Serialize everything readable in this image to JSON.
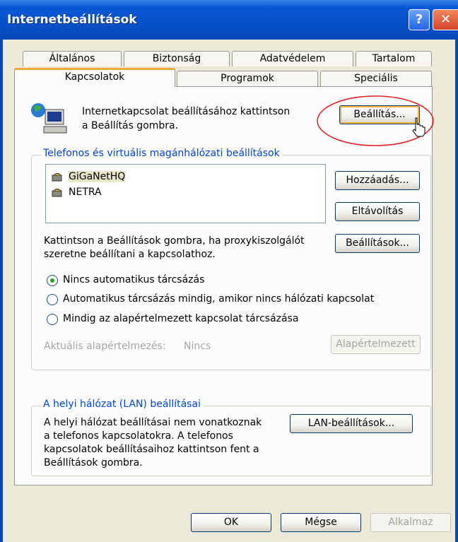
{
  "window": {
    "title": "Internetbeállítások",
    "help_glyph": "?",
    "close_glyph": "✕"
  },
  "tabs": {
    "row1": [
      "Általános",
      "Biztonság",
      "Adatvédelem",
      "Tartalom"
    ],
    "row2": [
      "Kapcsolatok",
      "Programok",
      "Speciális"
    ],
    "active": "Kapcsolatok"
  },
  "setup": {
    "text_line1": "Internetkapcsolat beállításához kattintson",
    "text_line2": "a Beállítás gombra.",
    "button": "Beállítás..."
  },
  "dialup": {
    "legend": "Telefonos és virtuális magánhálózati beállítások",
    "connections": [
      "GiGaNetHQ",
      "NETRA"
    ],
    "add_button": "Hozzáadás...",
    "remove_button": "Eltávolítás",
    "proxy_text_line1": "Kattintson a Beállítások gombra, ha proxykiszolgálót",
    "proxy_text_line2": "szeretne beállítani a kapcsolathoz.",
    "settings_button": "Beállítások...",
    "radio1": "Nincs automatikus tárcsázás",
    "radio2": "Automatikus tárcsázás mindig, amikor nincs hálózati kapcsolat",
    "radio3": "Mindig az alapértelmezett kapcsolat tárcsázása",
    "selected_radio": 1,
    "current_default_label": "Aktuális alapértelmezés:",
    "current_default_value": "Nincs",
    "set_default_button": "Alapértelmezett"
  },
  "lan": {
    "legend": "A helyi hálózat (LAN) beállításai",
    "text_line1": "A helyi hálózat beállításai nem vonatkoznak",
    "text_line2": "a telefonos kapcsolatokra. A telefonos",
    "text_line3": "kapcsolatok beállításaihoz kattintson fent a",
    "text_line4": "Beállítások gombra.",
    "button": "LAN-beállítások..."
  },
  "footer": {
    "ok": "OK",
    "cancel": "Mégse",
    "apply": "Alkalmaz"
  },
  "colors": {
    "titlebar": "#0551c8",
    "legend_text": "#0046d5",
    "highlight_ellipse": "#e02020",
    "active_tab_accent": "#f2a93a"
  }
}
